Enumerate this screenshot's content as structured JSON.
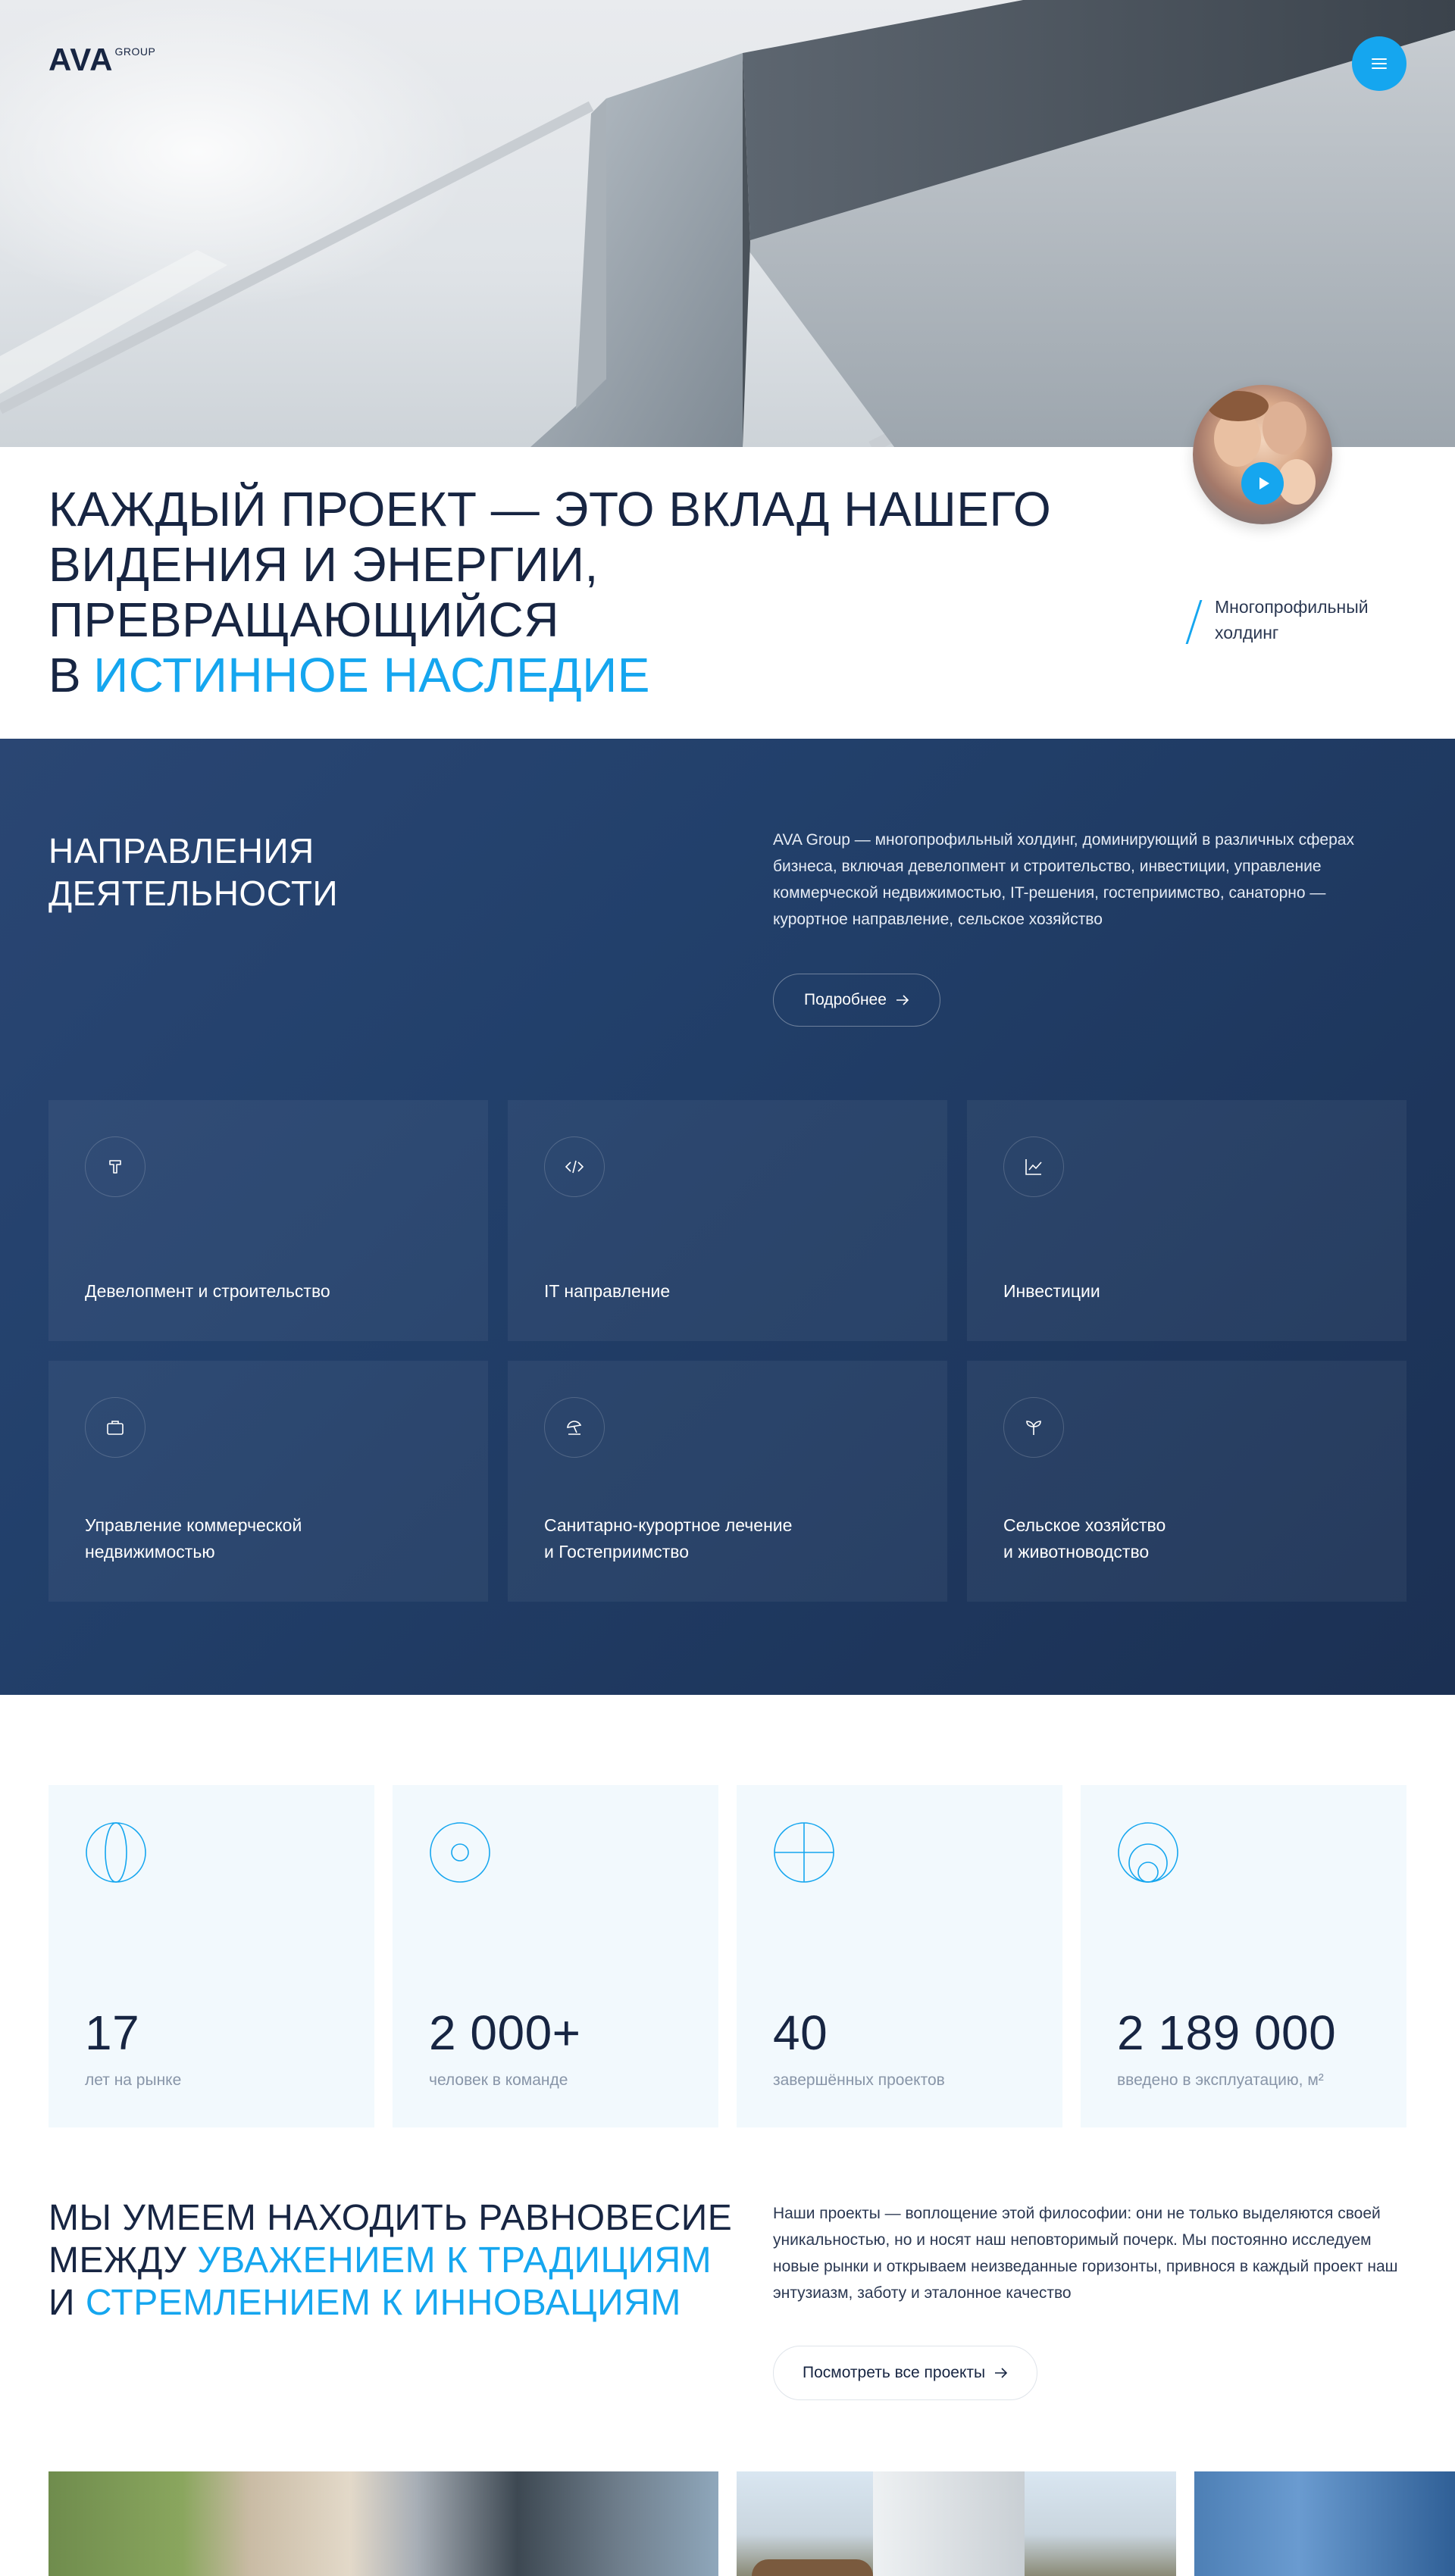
{
  "header": {
    "logo_main": "AVA",
    "logo_sub": "GROUP",
    "menu_icon": "hamburger-icon"
  },
  "hero": {
    "video_icon": "play-icon"
  },
  "intro": {
    "heading_line1": "КАЖДЫЙ ПРОЕКТ — ЭТО ВКЛАД НАШЕГО",
    "heading_line2": "ВИДЕНИЯ И ЭНЕРГИИ, ПРЕВРАЩАЮЩИЙСЯ",
    "heading_line3_prefix": "В",
    "heading_line3_accent": "ИСТИННОЕ НАСЛЕДИЕ",
    "tag": "Многопрофильный холдинг"
  },
  "directions": {
    "title_line1": "НАПРАВЛЕНИЯ",
    "title_line2": "ДЕЯТЕЛЬНОСТИ",
    "description": "AVA Group — многопрофильный холдинг, доминирующий в различных сферах бизнеса, включая девелопмент и строительство, инвестиции, управление коммерческой недвижимостью, IT-решения, гостеприимство, санаторно — курортное направление, сельское хозяйство",
    "more_label": "Подробнее",
    "more_icon": "arrow-right-icon",
    "cards": [
      {
        "label": "Девелопмент и строительство",
        "icon": "trowel-icon"
      },
      {
        "label": "IT направление",
        "icon": "code-icon"
      },
      {
        "label": "Инвестиции",
        "icon": "chart-line-icon"
      },
      {
        "label": "Управление коммерческой\nнедвижимостью",
        "icon": "briefcase-icon"
      },
      {
        "label": "Санитарно-курортное лечение\nи Гостеприимство",
        "icon": "beach-umbrella-icon"
      },
      {
        "label": "Сельское хозяйство\nи животноводство",
        "icon": "sprout-icon"
      }
    ]
  },
  "stats": [
    {
      "value": "17",
      "caption": "лет на рынке",
      "icon": "globe-icon"
    },
    {
      "value": "2 000+",
      "caption": "человек в команде",
      "icon": "target-icon"
    },
    {
      "value": "40",
      "caption": "завершённых проектов",
      "icon": "crosshair-icon"
    },
    {
      "value": "2 189 000",
      "caption": "введено в эксплуатацию, м²",
      "icon": "circles-icon"
    }
  ],
  "balance": {
    "line1": "МЫ УМЕЕМ НАХОДИТЬ РАВНОВЕСИЕ",
    "line2_prefix": "МЕЖДУ",
    "line2_accent": "УВАЖЕНИЕМ К ТРАДИЦИЯМ",
    "line3_prefix": "И",
    "line3_accent": "СТРЕМЛЕНИЕМ К ИННОВАЦИЯМ",
    "paragraph": "Наши проекты — воплощение этой философии: они не только выделяются своей уникальностью, но и носят наш неповторимый почерк. Мы постоянно исследуем новые рынки и открываем неизведанные горизонты, привнося в каждый проект наш энтузиазм, заботу и эталонное качество",
    "projects_label": "Посмотреть все проекты",
    "projects_icon": "arrow-right-icon"
  },
  "colors": {
    "accent": "#15a6ef",
    "navy": "#172542",
    "section_bg": "#22406b",
    "stat_bg": "#f2f9fd"
  }
}
